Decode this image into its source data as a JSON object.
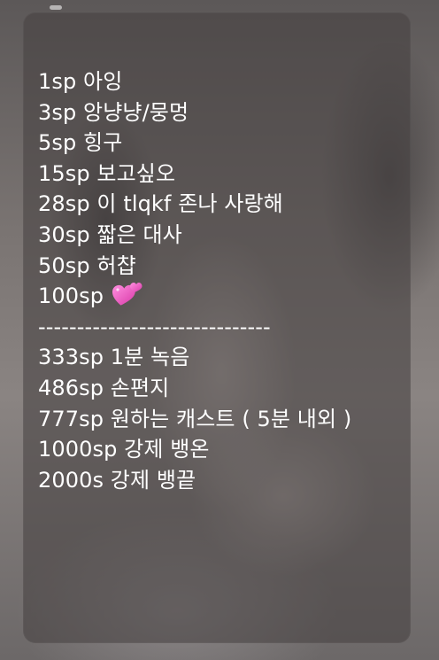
{
  "menu": {
    "items": [
      "1sp 아잉",
      "3sp 앙냥냥/뭉멍",
      "5sp 힝구",
      "15sp 보고싶오",
      "28sp 이 tlqkf 존나 사랑해",
      "30sp 짧은 대사",
      "50sp 허챱",
      "100sp"
    ],
    "heart_icon": "two-hearts-icon",
    "divider": "------------------------------",
    "items_after": [
      "333sp 1분 녹음",
      "486sp 손편지",
      "777sp 원하는 캐스트 ( 5분 내외 )",
      "1000sp 강제 뱅온",
      "2000s 강제 뱅끝"
    ]
  },
  "colors": {
    "text": "#ffffff",
    "card": "#464242",
    "heart": "#f25fc5"
  }
}
